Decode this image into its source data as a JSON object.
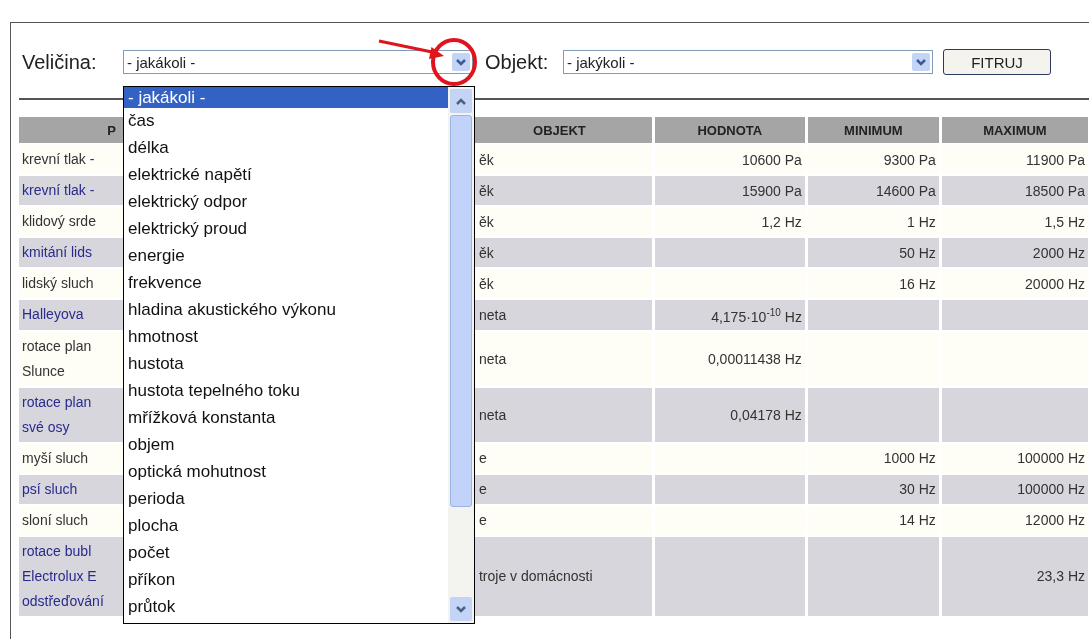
{
  "filters": [
    {
      "label": "Veličina:",
      "value": "- jakákoli -"
    },
    {
      "label": "Objekt:",
      "value": "- jakýkoli -"
    }
  ],
  "filter_button": "FITRUJ",
  "dropdown": {
    "items": [
      {
        "label": "- jakákoli -",
        "selected": true
      },
      {
        "label": "čas",
        "selected": false
      },
      {
        "label": "délka",
        "selected": false
      },
      {
        "label": "elektrické napětí",
        "selected": false
      },
      {
        "label": "elektrický odpor",
        "selected": false
      },
      {
        "label": "elektrický proud",
        "selected": false
      },
      {
        "label": "energie",
        "selected": false
      },
      {
        "label": "frekvence",
        "selected": false
      },
      {
        "label": "hladina akustického výkonu",
        "selected": false
      },
      {
        "label": "hmotnost",
        "selected": false
      },
      {
        "label": "hustota",
        "selected": false
      },
      {
        "label": "hustota tepelného toku",
        "selected": false
      },
      {
        "label": "mřížková konstanta",
        "selected": false
      },
      {
        "label": "objem",
        "selected": false
      },
      {
        "label": "optická mohutnost",
        "selected": false
      },
      {
        "label": "perioda",
        "selected": false
      },
      {
        "label": "plocha",
        "selected": false
      },
      {
        "label": "počet",
        "selected": false
      },
      {
        "label": "příkon",
        "selected": false
      },
      {
        "label": "průtok",
        "selected": false
      }
    ]
  },
  "table": {
    "columns": [
      "P",
      "OBJEKT",
      "HODNOTA",
      "MINIMUM",
      "MAXIMUM"
    ],
    "rows": [
      {
        "cells": [
          "krevní tlak -",
          "ěk",
          "10600 Pa",
          "9300 Pa",
          "11900 Pa"
        ]
      },
      {
        "cells": [
          "krevní tlak -",
          "ěk",
          "15900 Pa",
          "14600 Pa",
          "18500 Pa"
        ]
      },
      {
        "cells": [
          "klidový srde",
          "ěk",
          "1,2 Hz",
          "1 Hz",
          "1,5 Hz"
        ]
      },
      {
        "cells": [
          "kmitání lids",
          "ěk",
          "",
          "50 Hz",
          "2000 Hz"
        ]
      },
      {
        "cells": [
          "lidský sluch",
          "ěk",
          "",
          "16 Hz",
          "20000 Hz"
        ]
      },
      {
        "cells": [
          "Halleyova",
          "neta",
          "4,175·10$^{-10}$ Hz",
          "",
          ""
        ]
      },
      {
        "cells": [
          "rotace plan\nSlunce",
          "neta",
          "0,00011438 Hz",
          "",
          ""
        ]
      },
      {
        "cells": [
          "rotace plan\nsvé osy",
          "neta",
          "0,04178 Hz",
          "",
          ""
        ]
      },
      {
        "cells": [
          "myší sluch",
          "e",
          "",
          "1000 Hz",
          "100000 Hz"
        ]
      },
      {
        "cells": [
          "psí sluch",
          "e",
          "",
          "30 Hz",
          "100000 Hz"
        ]
      },
      {
        "cells": [
          "sloní sluch",
          "e",
          "",
          "14 Hz",
          "12000 Hz"
        ]
      },
      {
        "cells": [
          "rotace bubl\nElectrolux E\nodstřeďování",
          "troje v domácnosti",
          "",
          "",
          "23,3 Hz"
        ]
      }
    ]
  }
}
